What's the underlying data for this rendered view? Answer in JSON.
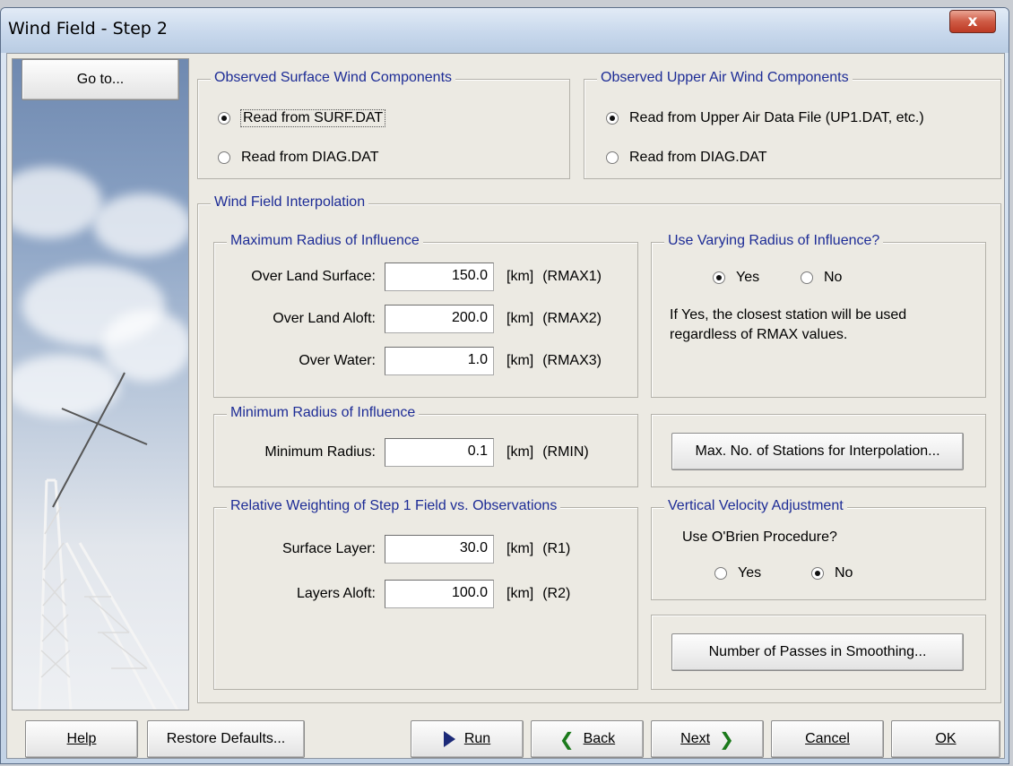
{
  "window": {
    "title": "Wind Field - Step 2",
    "close_glyph": "x"
  },
  "goto_label": "Go to...",
  "surface": {
    "legend": "Observed Surface Wind Components",
    "options": [
      "Read from SURF.DAT",
      "Read from DIAG.DAT"
    ],
    "selected": 0
  },
  "upper": {
    "legend": "Observed Upper Air Wind Components",
    "options": [
      "Read from Upper Air Data File (UP1.DAT, etc.)",
      "Read from DIAG.DAT"
    ],
    "selected": 0
  },
  "interp": {
    "legend": "Wind Field Interpolation",
    "max_radius": {
      "legend": "Maximum Radius of Influence",
      "rows": [
        {
          "label": "Over Land Surface:",
          "value": "150.0",
          "unit": "[km]",
          "code": "(RMAX1)"
        },
        {
          "label": "Over Land Aloft:",
          "value": "200.0",
          "unit": "[km]",
          "code": "(RMAX2)"
        },
        {
          "label": "Over Water:",
          "value": "1.0",
          "unit": "[km]",
          "code": "(RMAX3)"
        }
      ]
    },
    "varying": {
      "legend": "Use Varying Radius of Influence?",
      "yes": "Yes",
      "no": "No",
      "selected": "yes",
      "note_line1": "If Yes, the closest station will be used",
      "note_line2": "regardless of RMAX values."
    },
    "min_radius": {
      "legend": "Minimum Radius of Influence",
      "label": "Minimum Radius:",
      "value": "0.1",
      "unit": "[km]",
      "code": "(RMIN)"
    },
    "max_stations_button": "Max. No. of Stations for Interpolation...",
    "weighting": {
      "legend": "Relative Weighting of Step 1 Field vs. Observations",
      "rows": [
        {
          "label": "Surface Layer:",
          "value": "30.0",
          "unit": "[km]",
          "code": "(R1)"
        },
        {
          "label": "Layers Aloft:",
          "value": "100.0",
          "unit": "[km]",
          "code": "(R2)"
        }
      ]
    },
    "vertical": {
      "legend": "Vertical Velocity Adjustment",
      "question": "Use O'Brien Procedure?",
      "yes": "Yes",
      "no": "No",
      "selected": "no"
    },
    "smoothing_button": "Number of Passes in Smoothing..."
  },
  "footer": {
    "help": "Help",
    "restore": "Restore Defaults...",
    "run": "Run",
    "back": "Back",
    "next": "Next",
    "cancel": "Cancel",
    "ok": "OK"
  }
}
